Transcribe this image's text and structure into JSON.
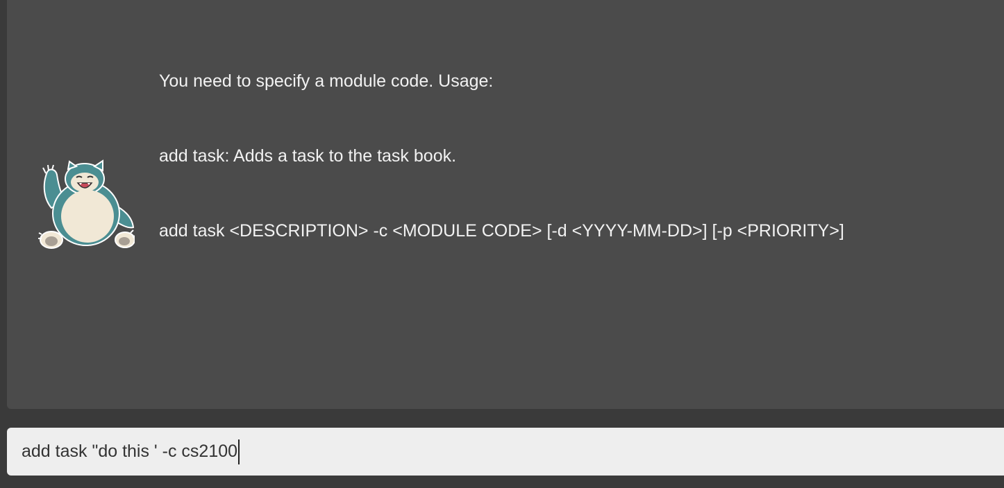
{
  "result_display": {
    "lines": [
      "You need to specify a module code. Usage:",
      "add task: Adds a task to the task book.",
      "add task <DESCRIPTION> -c <MODULE CODE> [-d <YYYY-MM-DD>] [-p <PRIORITY>]"
    ],
    "avatar_icon": "snorlax-mascot-icon"
  },
  "command_box": {
    "value": "add task \"do this ' -c cs2100"
  },
  "colors": {
    "background": "#3a3a3a",
    "panel": "#4b4b4b",
    "text": "#f2f2f2",
    "input_bg": "#eeeeee",
    "mascot_body": "#4b8e92",
    "mascot_belly": "#f1e8d6"
  }
}
